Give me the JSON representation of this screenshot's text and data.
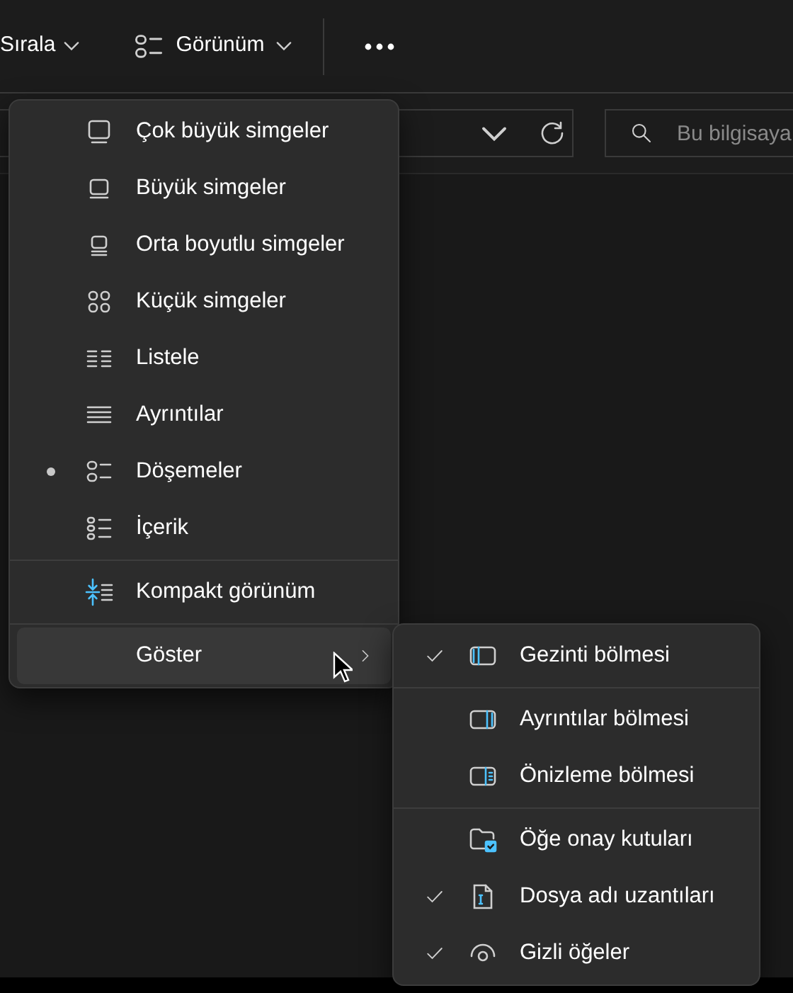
{
  "toolbar": {
    "sort_label": "Sırala",
    "view_label": "Görünüm"
  },
  "address_bar": {
    "search_placeholder": "Bu bilgisaya"
  },
  "view_menu": {
    "groups": [
      [
        {
          "label": "Çok büyük simgeler",
          "selected": false
        },
        {
          "label": "Büyük simgeler",
          "selected": false
        },
        {
          "label": "Orta boyutlu simgeler",
          "selected": false
        },
        {
          "label": "Küçük simgeler",
          "selected": false
        },
        {
          "label": "Listele",
          "selected": false
        },
        {
          "label": "Ayrıntılar",
          "selected": false
        },
        {
          "label": "Döşemeler",
          "selected": true
        },
        {
          "label": "İçerik",
          "selected": false
        }
      ],
      [
        {
          "label": "Kompakt görünüm",
          "checked": false
        }
      ],
      [
        {
          "label": "Göster",
          "expanded": true
        }
      ]
    ]
  },
  "show_submenu": {
    "groups": [
      [
        {
          "label": "Gezinti bölmesi",
          "checked": true
        }
      ],
      [
        {
          "label": "Ayrıntılar bölmesi",
          "checked": false
        },
        {
          "label": "Önizleme bölmesi",
          "checked": false
        }
      ],
      [
        {
          "label": "Öğe onay kutuları",
          "checked": false
        },
        {
          "label": "Dosya adı uzantıları",
          "checked": true
        },
        {
          "label": "Gizli öğeler",
          "checked": true
        }
      ]
    ]
  }
}
